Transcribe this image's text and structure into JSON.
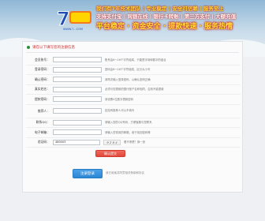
{
  "banner": {
    "logo_text": "7",
    "logo_sub": "WWW.7...COM",
    "slogan_line1": "我们有7年技术团队 | 专业稳定 | 安全可信赖 | 服务至上",
    "slogan_line2": "支持支付宝 | 网银在线 | 银行卡转账 | 第三方支付 | 大额充值",
    "slogan_line3": "平台稳定 · 资金安全 · 提款快速 · 服务热情",
    "colors": {
      "sky": "#8fb7d6",
      "slogan_red": "#c41a1a",
      "slogan_yellow": "#ffe23a"
    }
  },
  "notice": {
    "text": "请在以下填写您的注册信息"
  },
  "form": {
    "rows": [
      {
        "label": "会员账号：",
        "value": "",
        "hint": "账号由6～16个字符组成，只能是字母和数字的组合"
      },
      {
        "label": "登录密码：",
        "value": "",
        "hint": "密码由6～16个字符组成，区分大小写"
      },
      {
        "label": "确认密码：",
        "value": "",
        "hint": "请再次输入登录密码，以确认密码正确"
      },
      {
        "label": "真实姓名：",
        "value": "",
        "hint": "必须与您提款的银行账户名称相同，否则不能提款"
      },
      {
        "label": "提款密码：",
        "value": "",
        "hint": "请设置4位数字提款密码"
      },
      {
        "label": "推荐人：",
        "value": "",
        "hint": "如没有推荐人可以不填写"
      },
      {
        "label": "联系QQ：",
        "value": "",
        "hint": "请输入您的QQ号码，方便客服与您联系"
      },
      {
        "label": "电子邮箱：",
        "value": "",
        "hint": "请输入您常用的邮箱，用于找回密码等"
      },
      {
        "label": "验证码：",
        "value": "480003",
        "hint": "看不清楚？换一张",
        "captcha": "9 2 8 4"
      }
    ],
    "submit_label": "确认提交"
  },
  "footer": {
    "button_label": "注册登录",
    "note": "我已阅读并同意相关条款和协议"
  }
}
